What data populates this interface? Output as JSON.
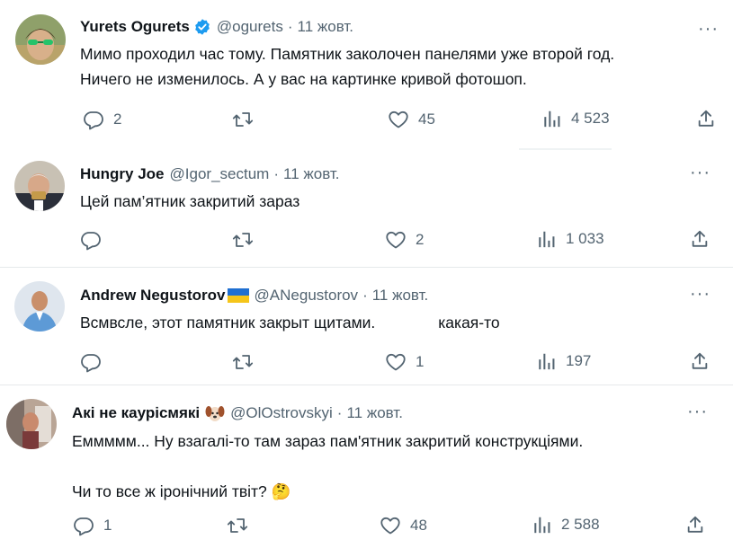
{
  "tweets": [
    {
      "name": "Yurets Ogurets",
      "handle": "@ogurets",
      "separator": "·",
      "date": "11 жовт.",
      "text_lines": [
        "Мимо проходил час тому. Памятник заколочен панелями уже второй год.",
        "Ничего не изменилось. А у вас на картинке кривой фотошоп."
      ],
      "replies": "2",
      "reposts": "",
      "likes": "45",
      "views": "4 523"
    },
    {
      "name": "Hungry Joe",
      "handle": "@Igor_sectum",
      "separator": "·",
      "date": "11 жовт.",
      "text_lines": [
        "Цей пам’ятник закритий зараз"
      ],
      "replies": "",
      "reposts": "",
      "likes": "2",
      "views": "1 033"
    },
    {
      "name": "Andrew Negustorov",
      "handle": "@ANegustorov",
      "separator": "·",
      "date": "11 жовт.",
      "text_part1": "Всмвсле, этот памятник закрыт щитами.",
      "text_part2": "какая-то",
      "replies": "",
      "reposts": "",
      "likes": "1",
      "views": "197"
    },
    {
      "name": "Акі не каурісмякі",
      "handle": "@OlOstrovskyi",
      "separator": "·",
      "date": "11 жовт.",
      "text_line1": "Еммммм... Ну взагалі-то там зараз пам'ятник закритий конструкціями.",
      "text_line2": "Чи то все ж іронічний твіт?",
      "emoji": "🤔",
      "replies": "1",
      "reposts": "",
      "likes": "48",
      "views": "2 588"
    }
  ],
  "more_label": "···",
  "colors": {
    "verified": "#1d9bf0",
    "muted": "#536471",
    "text": "#0f1419",
    "divider": "#e6e9eb"
  }
}
